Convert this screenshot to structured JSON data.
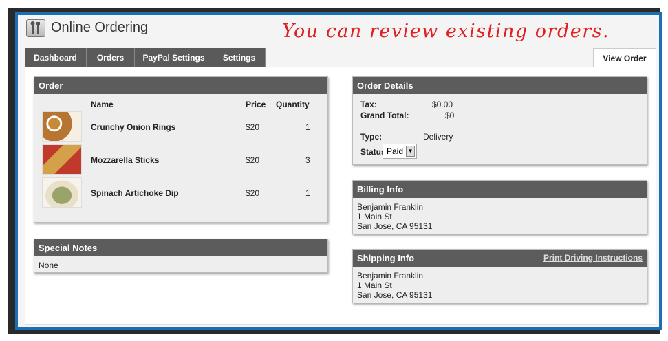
{
  "app": {
    "title": "Online Ordering",
    "icon": "tools-icon"
  },
  "annotation": "You can review existing orders.",
  "tabs": [
    {
      "label": "Dashboard"
    },
    {
      "label": "Orders"
    },
    {
      "label": "PayPal Settings"
    },
    {
      "label": "Settings"
    }
  ],
  "active_tab": "View Order",
  "order": {
    "title": "Order",
    "headers": {
      "name": "Name",
      "price": "Price",
      "quantity": "Quantity"
    },
    "items": [
      {
        "name": "Crunchy Onion Rings",
        "price": "$20",
        "quantity": "1"
      },
      {
        "name": "Mozzarella Sticks",
        "price": "$20",
        "quantity": "3"
      },
      {
        "name": "Spinach Artichoke Dip",
        "price": "$20",
        "quantity": "1"
      }
    ]
  },
  "notes": {
    "title": "Special Notes",
    "text": "None"
  },
  "details": {
    "title": "Order Details",
    "tax_label": "Tax:",
    "tax": "$0.00",
    "total_label": "Grand Total:",
    "total": "$0",
    "type_label": "Type:",
    "type": "Delivery",
    "status_label": "Status:",
    "status": "Paid"
  },
  "billing": {
    "title": "Billing Info",
    "name": "Benjamin Franklin",
    "street": "1 Main St",
    "city": "San Jose, CA 95131"
  },
  "shipping": {
    "title": "Shipping Info",
    "link": "Print Driving Instructions",
    "name": "Benjamin Franklin",
    "street": "1 Main St",
    "city": "San Jose, CA 95131"
  },
  "colors": {
    "frame": "#1a6fb5",
    "header": "#5c5c5c",
    "annotation": "#e02020"
  }
}
